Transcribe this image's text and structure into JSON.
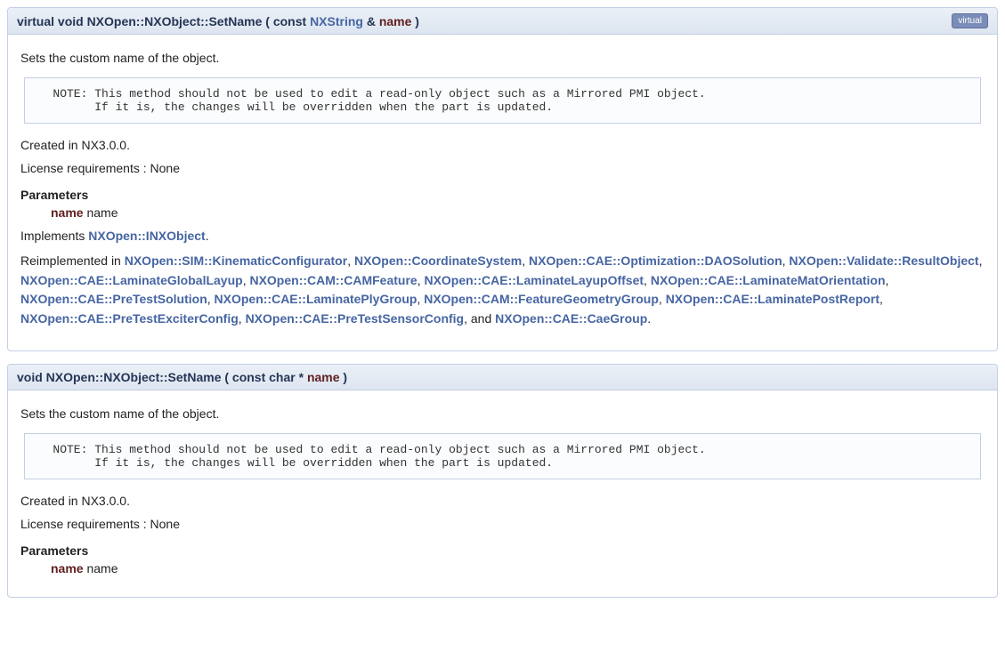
{
  "method1": {
    "sig_prefix": "virtual void NXOpen::NXObject::SetName ( const ",
    "type_link": "NXString",
    "sig_mid": " &  ",
    "param_name": "name",
    "sig_suffix": " )",
    "virtual_badge": "virtual",
    "desc": "Sets the custom name of the object.",
    "note": "   NOTE: This method should not be used to edit a read-only object such as a Mirrored PMI object.\n         If it is, the changes will be overridden when the part is updated.\n",
    "created": "Created in NX3.0.0.",
    "license": "License requirements : None",
    "params_label": "Parameters",
    "param_pname": "name",
    "param_pdesc": "name",
    "implements_prefix": "Implements ",
    "implements_link": "NXOpen::INXObject",
    "implements_suffix": ".",
    "reimpl_prefix": "Reimplemented in ",
    "reimpl_links": [
      "NXOpen::SIM::KinematicConfigurator",
      "NXOpen::CoordinateSystem",
      "NXOpen::CAE::Optimization::DAOSolution",
      "NXOpen::Validate::ResultObject",
      "NXOpen::CAE::LaminateGlobalLayup",
      "NXOpen::CAM::CAMFeature",
      "NXOpen::CAE::LaminateLayupOffset",
      "NXOpen::CAE::LaminateMatOrientation",
      "NXOpen::CAE::PreTestSolution",
      "NXOpen::CAE::LaminatePlyGroup",
      "NXOpen::CAM::FeatureGeometryGroup",
      "NXOpen::CAE::LaminatePostReport",
      "NXOpen::CAE::PreTestExciterConfig",
      "NXOpen::CAE::PreTestSensorConfig",
      "NXOpen::CAE::CaeGroup"
    ],
    "reimpl_and": ", and ",
    "reimpl_suffix": "."
  },
  "method2": {
    "sig_prefix": "void NXOpen::NXObject::SetName ( const char *  ",
    "param_name": "name",
    "sig_suffix": " )",
    "desc": "Sets the custom name of the object.",
    "note": "   NOTE: This method should not be used to edit a read-only object such as a Mirrored PMI object.\n         If it is, the changes will be overridden when the part is updated.\n",
    "created": "Created in NX3.0.0.",
    "license": "License requirements : None",
    "params_label": "Parameters",
    "param_pname": "name",
    "param_pdesc": "name"
  }
}
